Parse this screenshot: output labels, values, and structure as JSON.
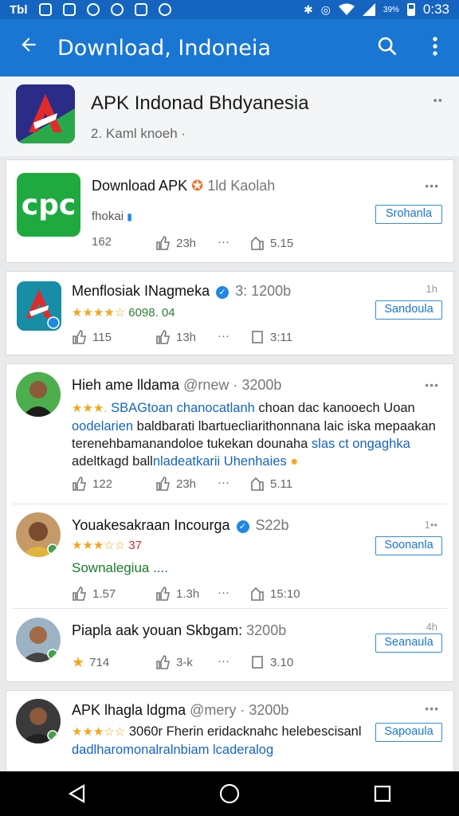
{
  "status_bar": {
    "left_text": "Tbl",
    "battery": "39%",
    "time": "0:33"
  },
  "app_bar": {
    "title": "Download, Indoneia",
    "back_icon": "arrow-back-icon",
    "search_icon": "search-icon",
    "menu_icon": "more-vert-icon"
  },
  "header": {
    "title": "APK Indonad Bhdyanesia",
    "subtitle": "2. Kaml knoeh ·"
  },
  "card1": {
    "name": "Download APK",
    "meta": "1ld Kaolah",
    "tag": "fhokai",
    "button": "Srohanla",
    "likes": "162",
    "shares": "23h",
    "more": "···",
    "views": "5.15"
  },
  "card2": {
    "name": "Menflosiak INagmeka",
    "meta": "3: 1200b",
    "time": "1h",
    "stars": "★★★★☆",
    "rating_text": "6098. 04",
    "button": "Sandoula",
    "likes": "115",
    "shares": "13h",
    "more": "···",
    "views": "3:11"
  },
  "post1": {
    "name": "Hieh ame lldama",
    "meta": "@rnew · 3200b",
    "stars": "★★★.",
    "text_blue": "SBAGtoan chanocatlanh",
    "text_rest": " choan dac kanooech Uoan",
    "line2_blue": "oodelarien",
    "line2_rest": " baldbarati lbartuecliarithonnana laic iska mepaakan",
    "line3_rest": "terenehbamanandoloe tukekan dounaha ",
    "line3_blue": "slas ct ongaghka",
    "line4_rest": "adeltkagd ball",
    "line4_blue": "nladeatkarii Uhenhaies",
    "likes": "122",
    "shares": "23h",
    "more": "···",
    "views": "5.11"
  },
  "post2": {
    "name": "Youakesakraan Incourga",
    "meta": "S22b",
    "time": "1••",
    "stars": "★★★☆☆",
    "rating_text": "37",
    "green": "Sownalegiua ....",
    "button": "Soonanla",
    "likes": "1.57",
    "shares": "1.3h",
    "more": "···",
    "views": "15:10"
  },
  "post3": {
    "name": "Piapla aak youan Skbgam:",
    "meta": "3200b",
    "time": "4h",
    "button": "Seanaula",
    "likes": "714",
    "shares": "3-k",
    "more": "···",
    "views": "3.10"
  },
  "post4": {
    "name": "APK lhagla ldgma",
    "meta": "@mery · 3200b",
    "stars": "★★★☆☆",
    "line1": "3060r Fherin eridacknahc helebescisanl",
    "line2": "dadlharomonalralnbiam lcaderalog",
    "button": "Sapoaula"
  },
  "colors": {
    "appbar": "#1976d2",
    "statusbar": "#1565c0",
    "accent": "#1976d2",
    "star": "#f4a51c",
    "green": "#1b7a2a"
  }
}
